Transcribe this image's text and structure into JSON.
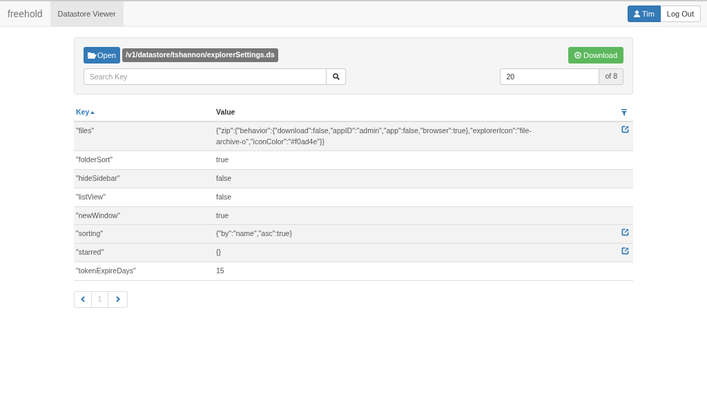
{
  "navbar": {
    "brand": "freehold",
    "nav_items": [
      {
        "label": "Datastore Viewer",
        "selected": true
      }
    ],
    "user_button": "Tim",
    "logout_button": "Log Out"
  },
  "toolbar": {
    "open_button": "Open",
    "file_path": "/v1/datastore/tshannon/explorerSettings.ds",
    "download_button": "Download",
    "search": {
      "placeholder": "Search Key"
    },
    "page_size": "20",
    "page_count": "of 8"
  },
  "table": {
    "columns": [
      {
        "label": "Key",
        "sorted": true
      },
      {
        "label": "Value",
        "sorted": false
      }
    ],
    "rows": [
      {
        "key": "\"files\"",
        "value": "{\"zip\":{\"behavior\":{\"download\":false,\"appID\":\"admin\",\"app\":false,\"browser\":true},\"explorerIcon\":\"file-archive-o\",\"iconColor\":\"#f0ad4e\"}}",
        "shaded": true,
        "has_link": true
      },
      {
        "key": "\"folderSort\"",
        "value": "true",
        "shaded": false,
        "has_link": false
      },
      {
        "key": "\"hideSidebar\"",
        "value": "false",
        "shaded": true,
        "has_link": false
      },
      {
        "key": "\"listView\"",
        "value": "false",
        "shaded": false,
        "has_link": false
      },
      {
        "key": "\"newWindow\"",
        "value": "true",
        "shaded": true,
        "has_link": false
      },
      {
        "key": "\"sorting\"",
        "value": "{\"by\":\"name\",\"asc\":true}",
        "shaded": true,
        "has_link": true
      },
      {
        "key": "\"starred\"",
        "value": "{}",
        "shaded": true,
        "has_link": true
      },
      {
        "key": "\"tokenExpireDays\"",
        "value": "15",
        "shaded": false,
        "has_link": false
      }
    ]
  },
  "pagination": {
    "pages": [
      {
        "label": "1",
        "selected": false
      }
    ]
  }
}
